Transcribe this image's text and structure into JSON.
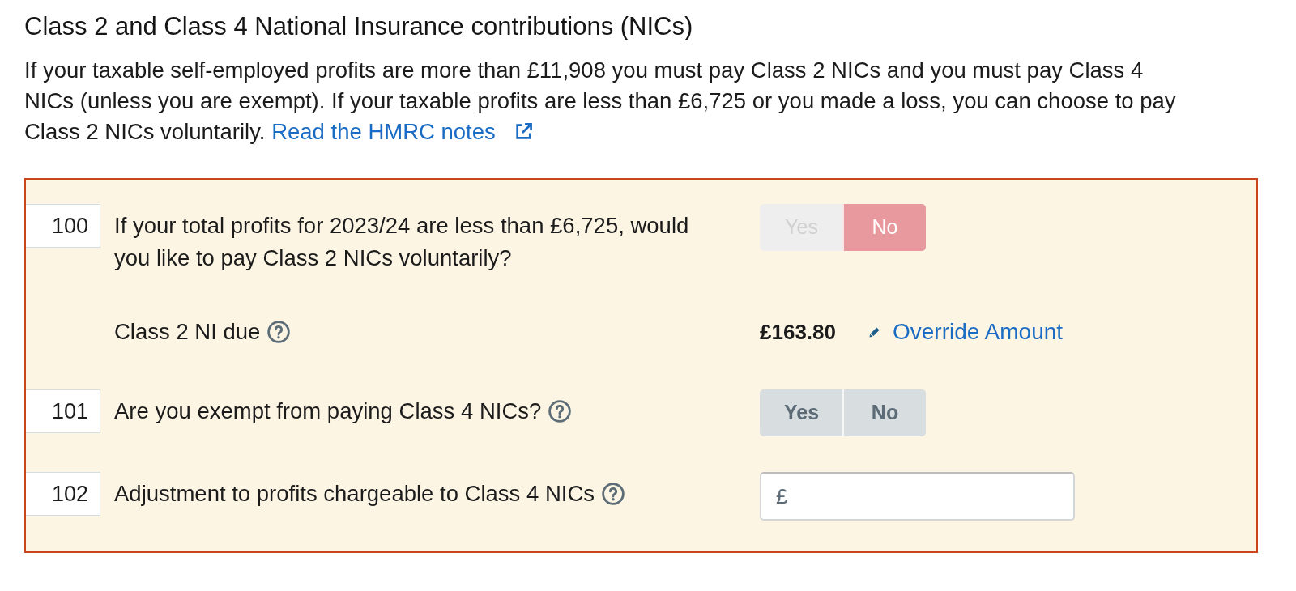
{
  "heading": "Class 2 and Class 4 National Insurance contributions (NICs)",
  "intro": {
    "text": "If your taxable self-employed profits are more than £11,908 you must pay Class 2 NICs and you must pay Class 4 NICs (unless you are exempt). If your taxable profits are less than £6,725 or you made a loss, you can choose to pay Class 2 NICs voluntarily.",
    "link": "Read the HMRC notes"
  },
  "rows": [
    {
      "kind": "choice",
      "number": "100",
      "label": "If your total profits for 2023/24 are less than £6,725, would you like to pay Class 2 NICs voluntarily?",
      "help": false,
      "disabled": true,
      "options": [
        {
          "label": "Yes",
          "selected": false
        },
        {
          "label": "No",
          "selected": true
        }
      ]
    },
    {
      "kind": "amount",
      "label": "Class 2 NI due",
      "help": true,
      "value": "£163.80",
      "action": "Override Amount"
    },
    {
      "kind": "choice",
      "number": "101",
      "label": "Are you exempt from paying Class 4 NICs?",
      "help": true,
      "disabled": false,
      "options": [
        {
          "label": "Yes",
          "selected": false
        },
        {
          "label": "No",
          "selected": false
        }
      ]
    },
    {
      "kind": "input",
      "number": "102",
      "label": "Adjustment to profits chargeable to Class 4 NICs",
      "help": true,
      "prefix": "£"
    }
  ]
}
